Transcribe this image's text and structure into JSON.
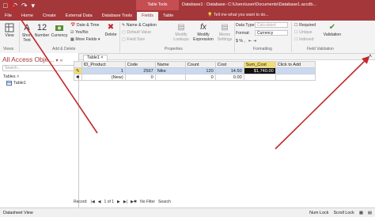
{
  "titlebar": {
    "contextual_label": "Table Tools",
    "doc_title": "Database1 : Database- C:\\Users\\user\\Documents\\Database1.accdb...",
    "tell_me": "Tell me what you want to do...",
    "tabs": [
      {
        "label": "File",
        "active": false
      },
      {
        "label": "Home",
        "active": false
      },
      {
        "label": "Create",
        "active": false
      },
      {
        "label": "External Data",
        "active": false
      },
      {
        "label": "Database Tools",
        "active": false
      },
      {
        "label": "Fields",
        "active": true
      },
      {
        "label": "Table",
        "active": false
      }
    ]
  },
  "ribbon": {
    "view_label": "View",
    "short_text_label": "Short Text",
    "number_label": "Number",
    "number_glyph": "12",
    "currency_label": "Currency",
    "date_time_label": "Date & Time",
    "yes_no_label": "Yes/No",
    "more_fields_label": "More Fields",
    "delete_label": "Delete",
    "name_caption_label": "Name & Caption",
    "default_value_label": "Default Value",
    "field_size_label": "Field Size",
    "modify_lookups_label": "Modify Lookups",
    "modify_expression_label": "Modify Expression",
    "memo_settings_label": "Memo Settings",
    "data_type_label": "Data Type:",
    "data_type_value": "Calculated",
    "format_label": "Format:",
    "format_value": "Currency",
    "required_label": "Required",
    "unique_label": "Unique",
    "indexed_label": "Indexed",
    "validation_label": "Validation",
    "groups": {
      "views": "Views",
      "add_delete": "Add & Delete",
      "properties": "Properties",
      "formatting": "Formatting",
      "field_validation": "Field Validation"
    }
  },
  "nav": {
    "title": "All Access Obje...",
    "search_placeholder": "Search...",
    "group": "Tables",
    "item": "Table1"
  },
  "doc_tab": "Table1",
  "grid": {
    "headers": [
      "ID_Product",
      "Code",
      "Name",
      "Count",
      "Cost",
      "Sum_Cost",
      "Click to Add"
    ],
    "rows": [
      [
        "1",
        "2567",
        "Nike",
        "120",
        "14.50",
        "$1,740.00",
        ""
      ],
      [
        "(New)",
        "0",
        "",
        "0",
        "0.00",
        "",
        ""
      ]
    ]
  },
  "record_nav": {
    "record_label": "Record:",
    "position": "1 of 1",
    "no_filter": "No Filter",
    "search": "Search"
  },
  "status": {
    "left": "Datasheet View",
    "num_lock": "Num Lock",
    "scroll_lock": "Scroll Lock"
  },
  "colors": {
    "brand": "#a4373a",
    "annotation": "#c0292b",
    "highlight": "#f4dd6e",
    "selection": "#c9d9f1"
  }
}
